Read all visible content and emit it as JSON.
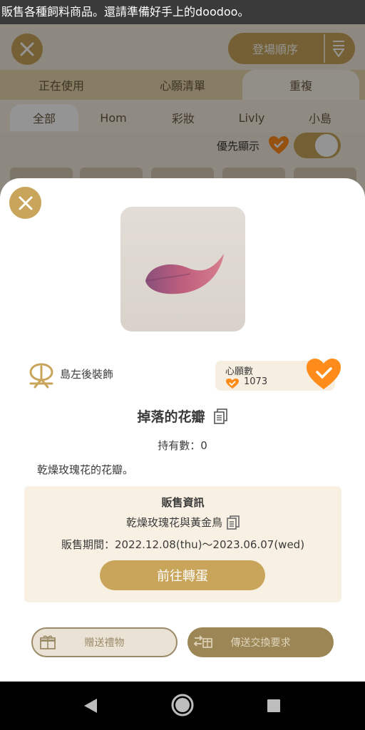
{
  "ticker": {
    "text": "販售各種飼料商品。還請準備好手上的doodoo。"
  },
  "background": {
    "sort_label": "登場順序",
    "tabs": [
      {
        "label": "正在使用"
      },
      {
        "label": "心願清單"
      },
      {
        "label": "重複"
      }
    ],
    "subtabs": [
      {
        "label": "全部"
      },
      {
        "label": "Hom"
      },
      {
        "label": "彩妝"
      },
      {
        "label": "Livly"
      },
      {
        "label": "小島"
      }
    ],
    "priority_label": "優先顯示"
  },
  "modal": {
    "category": "島左後裝飾",
    "wishlist": {
      "title": "心願數",
      "count": "1073"
    },
    "item_name": "掉落的花瓣",
    "owned": "持有數：0",
    "description": "乾燥玫瑰花的花瓣。",
    "sale": {
      "title": "販售資訊",
      "gacha_name": "乾燥玫瑰花與黃金鳥",
      "period": "販售期間：2022.12.08(thu)～2023.06.07(wed)",
      "go_button": "前往轉蛋"
    },
    "gift_button": "贈送禮物",
    "trade_button": "傳送交換要求"
  },
  "colors": {
    "accent": "#c9a55b",
    "heart": "#ff8c1a",
    "text": "#3a3a3a"
  }
}
